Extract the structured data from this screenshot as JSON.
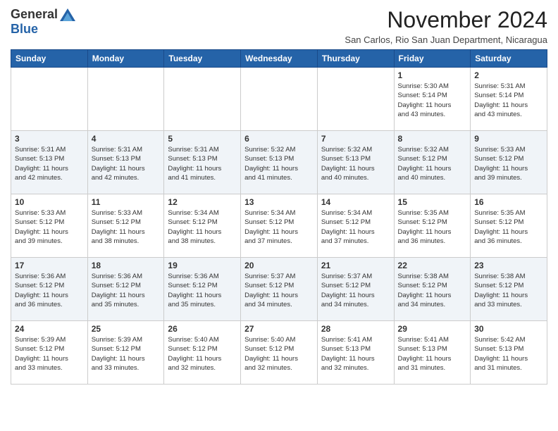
{
  "logo": {
    "general": "General",
    "blue": "Blue"
  },
  "title": "November 2024",
  "subtitle": "San Carlos, Rio San Juan Department, Nicaragua",
  "days_of_week": [
    "Sunday",
    "Monday",
    "Tuesday",
    "Wednesday",
    "Thursday",
    "Friday",
    "Saturday"
  ],
  "weeks": [
    [
      {
        "day": "",
        "info": ""
      },
      {
        "day": "",
        "info": ""
      },
      {
        "day": "",
        "info": ""
      },
      {
        "day": "",
        "info": ""
      },
      {
        "day": "",
        "info": ""
      },
      {
        "day": "1",
        "info": "Sunrise: 5:30 AM\nSunset: 5:14 PM\nDaylight: 11 hours\nand 43 minutes."
      },
      {
        "day": "2",
        "info": "Sunrise: 5:31 AM\nSunset: 5:14 PM\nDaylight: 11 hours\nand 43 minutes."
      }
    ],
    [
      {
        "day": "3",
        "info": "Sunrise: 5:31 AM\nSunset: 5:13 PM\nDaylight: 11 hours\nand 42 minutes."
      },
      {
        "day": "4",
        "info": "Sunrise: 5:31 AM\nSunset: 5:13 PM\nDaylight: 11 hours\nand 42 minutes."
      },
      {
        "day": "5",
        "info": "Sunrise: 5:31 AM\nSunset: 5:13 PM\nDaylight: 11 hours\nand 41 minutes."
      },
      {
        "day": "6",
        "info": "Sunrise: 5:32 AM\nSunset: 5:13 PM\nDaylight: 11 hours\nand 41 minutes."
      },
      {
        "day": "7",
        "info": "Sunrise: 5:32 AM\nSunset: 5:13 PM\nDaylight: 11 hours\nand 40 minutes."
      },
      {
        "day": "8",
        "info": "Sunrise: 5:32 AM\nSunset: 5:12 PM\nDaylight: 11 hours\nand 40 minutes."
      },
      {
        "day": "9",
        "info": "Sunrise: 5:33 AM\nSunset: 5:12 PM\nDaylight: 11 hours\nand 39 minutes."
      }
    ],
    [
      {
        "day": "10",
        "info": "Sunrise: 5:33 AM\nSunset: 5:12 PM\nDaylight: 11 hours\nand 39 minutes."
      },
      {
        "day": "11",
        "info": "Sunrise: 5:33 AM\nSunset: 5:12 PM\nDaylight: 11 hours\nand 38 minutes."
      },
      {
        "day": "12",
        "info": "Sunrise: 5:34 AM\nSunset: 5:12 PM\nDaylight: 11 hours\nand 38 minutes."
      },
      {
        "day": "13",
        "info": "Sunrise: 5:34 AM\nSunset: 5:12 PM\nDaylight: 11 hours\nand 37 minutes."
      },
      {
        "day": "14",
        "info": "Sunrise: 5:34 AM\nSunset: 5:12 PM\nDaylight: 11 hours\nand 37 minutes."
      },
      {
        "day": "15",
        "info": "Sunrise: 5:35 AM\nSunset: 5:12 PM\nDaylight: 11 hours\nand 36 minutes."
      },
      {
        "day": "16",
        "info": "Sunrise: 5:35 AM\nSunset: 5:12 PM\nDaylight: 11 hours\nand 36 minutes."
      }
    ],
    [
      {
        "day": "17",
        "info": "Sunrise: 5:36 AM\nSunset: 5:12 PM\nDaylight: 11 hours\nand 36 minutes."
      },
      {
        "day": "18",
        "info": "Sunrise: 5:36 AM\nSunset: 5:12 PM\nDaylight: 11 hours\nand 35 minutes."
      },
      {
        "day": "19",
        "info": "Sunrise: 5:36 AM\nSunset: 5:12 PM\nDaylight: 11 hours\nand 35 minutes."
      },
      {
        "day": "20",
        "info": "Sunrise: 5:37 AM\nSunset: 5:12 PM\nDaylight: 11 hours\nand 34 minutes."
      },
      {
        "day": "21",
        "info": "Sunrise: 5:37 AM\nSunset: 5:12 PM\nDaylight: 11 hours\nand 34 minutes."
      },
      {
        "day": "22",
        "info": "Sunrise: 5:38 AM\nSunset: 5:12 PM\nDaylight: 11 hours\nand 34 minutes."
      },
      {
        "day": "23",
        "info": "Sunrise: 5:38 AM\nSunset: 5:12 PM\nDaylight: 11 hours\nand 33 minutes."
      }
    ],
    [
      {
        "day": "24",
        "info": "Sunrise: 5:39 AM\nSunset: 5:12 PM\nDaylight: 11 hours\nand 33 minutes."
      },
      {
        "day": "25",
        "info": "Sunrise: 5:39 AM\nSunset: 5:12 PM\nDaylight: 11 hours\nand 33 minutes."
      },
      {
        "day": "26",
        "info": "Sunrise: 5:40 AM\nSunset: 5:12 PM\nDaylight: 11 hours\nand 32 minutes."
      },
      {
        "day": "27",
        "info": "Sunrise: 5:40 AM\nSunset: 5:12 PM\nDaylight: 11 hours\nand 32 minutes."
      },
      {
        "day": "28",
        "info": "Sunrise: 5:41 AM\nSunset: 5:13 PM\nDaylight: 11 hours\nand 32 minutes."
      },
      {
        "day": "29",
        "info": "Sunrise: 5:41 AM\nSunset: 5:13 PM\nDaylight: 11 hours\nand 31 minutes."
      },
      {
        "day": "30",
        "info": "Sunrise: 5:42 AM\nSunset: 5:13 PM\nDaylight: 11 hours\nand 31 minutes."
      }
    ]
  ]
}
